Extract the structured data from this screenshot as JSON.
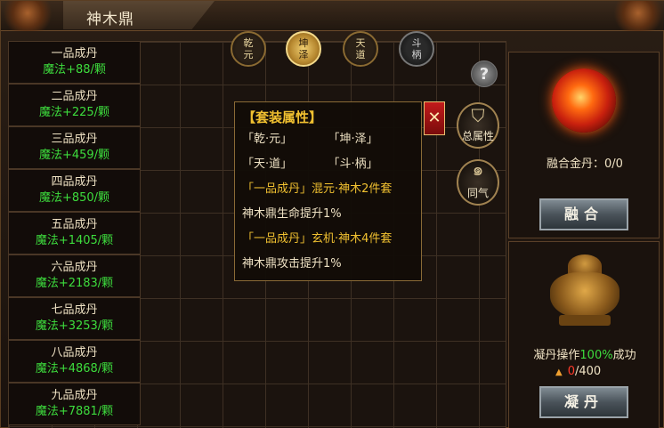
{
  "window": {
    "title": "神木鼎"
  },
  "tabs": [
    {
      "top": "乾",
      "bottom": "元",
      "state": "normal"
    },
    {
      "top": "坤",
      "bottom": "泽",
      "state": "active"
    },
    {
      "top": "天",
      "bottom": "道",
      "state": "normal"
    },
    {
      "top": "斗",
      "bottom": "柄",
      "state": "dark"
    }
  ],
  "items": [
    {
      "name": "一品成丹",
      "bonus": "魔法+88/颗"
    },
    {
      "name": "二品成丹",
      "bonus": "魔法+225/颗"
    },
    {
      "name": "三品成丹",
      "bonus": "魔法+459/颗"
    },
    {
      "name": "四品成丹",
      "bonus": "魔法+850/颗"
    },
    {
      "name": "五品成丹",
      "bonus": "魔法+1405/颗"
    },
    {
      "name": "六品成丹",
      "bonus": "魔法+2183/颗"
    },
    {
      "name": "七品成丹",
      "bonus": "魔法+3253/颗"
    },
    {
      "name": "八品成丹",
      "bonus": "魔法+4868/颗"
    },
    {
      "name": "九品成丹",
      "bonus": "魔法+7881/颗"
    }
  ],
  "help": {
    "symbol": "?"
  },
  "side_buttons": {
    "total_attr": "总属性",
    "same_qi": "同气"
  },
  "popup": {
    "title": "【套装属性】",
    "set_names": [
      "「乾·元」",
      "「坤·泽」",
      "「天·道」",
      "「斗·柄」"
    ],
    "set1_title": "「一品成丹」混元·神木2件套",
    "set1_effect": "神木鼎生命提升1%",
    "set2_title": "「一品成丹」玄机·神木4件套",
    "set2_effect": "神木鼎攻击提升1%",
    "close_symbol": "✕"
  },
  "fusion": {
    "label": "融合金丹：0/0",
    "button": "融合"
  },
  "refine": {
    "label_prefix": "凝丹操作",
    "label_percent": "100%",
    "label_suffix": "成功",
    "progress_current": "0",
    "progress_total": "/400",
    "button": "凝丹"
  },
  "colors": {
    "accent_gold": "#f0c030",
    "bonus_green": "#3ddc3d",
    "close_red": "#c21b1b"
  }
}
